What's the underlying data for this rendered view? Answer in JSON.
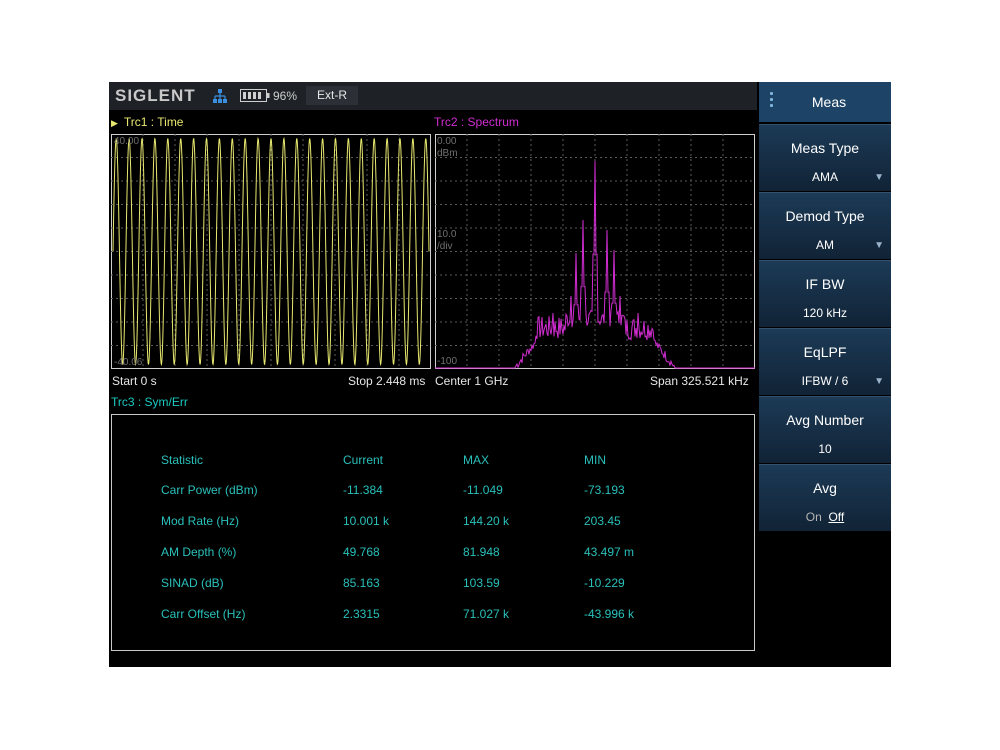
{
  "header": {
    "brand": "SIGLENT",
    "battery": "96%",
    "reference": "Ext-R"
  },
  "trace1": {
    "label": "Trc1 :  Time",
    "y_top": "40.00",
    "y_bottom": "-40.06",
    "start": "Start 0 s",
    "stop": "Stop 2.448 ms"
  },
  "trace2": {
    "label": "Trc2 :  Spectrum",
    "ref_level": "0.00",
    "ref_unit": "dBm",
    "scale": "10.0",
    "scale_unit": "/div",
    "bottom_level": "-100",
    "center": "Center 1 GHz",
    "span": "Span 325.521 kHz"
  },
  "trace3": {
    "label": "Trc3 :  Sym/Err"
  },
  "stats": {
    "headers": [
      "Statistic",
      "Current",
      "MAX",
      "MIN"
    ],
    "rows": [
      [
        "Carr Power (dBm)",
        "-11.384",
        "-11.049",
        "-73.193"
      ],
      [
        "Mod Rate (Hz)",
        "10.001 k",
        "144.20 k",
        "203.45"
      ],
      [
        "AM Depth (%)",
        "49.768",
        "81.948",
        "43.497 m"
      ],
      [
        "SINAD (dB)",
        "85.163",
        "103.59",
        "-10.229"
      ],
      [
        "Carr Offset (Hz)",
        "2.3315",
        "71.027 k",
        "-43.996 k"
      ]
    ]
  },
  "menu": {
    "title": "Meas",
    "items": [
      {
        "label": "Meas Type",
        "value": "AMA"
      },
      {
        "label": "Demod Type",
        "value": "AM"
      },
      {
        "label": "IF BW",
        "value": "120 kHz"
      },
      {
        "label": "EqLPF",
        "value": "IFBW / 6"
      },
      {
        "label": "Avg Number",
        "value": "10"
      },
      {
        "label": "Avg",
        "on": "On",
        "off": "Off"
      }
    ]
  },
  "colors": {
    "trace1": "#e8e870",
    "trace2": "#d02cd0",
    "trace3": "#19c9c0",
    "menu_bg": "#1d4466"
  }
}
